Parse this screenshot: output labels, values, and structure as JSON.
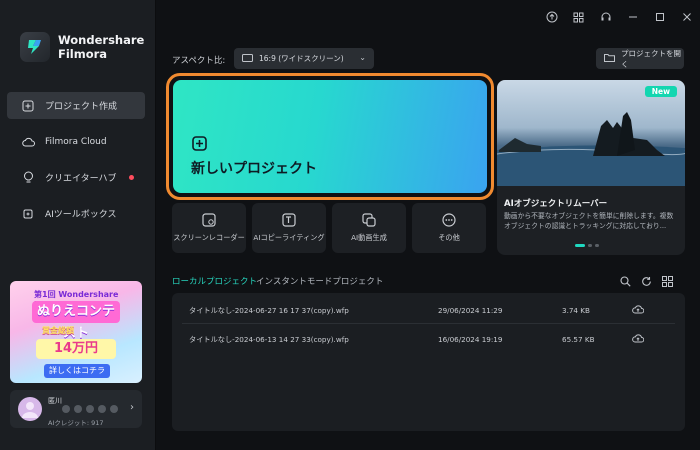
{
  "app": {
    "name_line1": "Wondershare",
    "name_line2": "Filmora",
    "accent": "#27d6bf"
  },
  "sidebar": {
    "items": [
      {
        "label": "プロジェクト作成",
        "icon": "new-project-icon",
        "active": true
      },
      {
        "label": "Filmora Cloud",
        "icon": "cloud-icon",
        "active": false
      },
      {
        "label": "クリエイターハブ",
        "icon": "lightbulb-icon",
        "active": false,
        "notification_dot": true
      },
      {
        "label": "AIツールボックス",
        "icon": "ai-toolbox-icon",
        "active": false
      }
    ],
    "banner": {
      "line1": "第1回 Wondershare Filmora",
      "line2": "ぬりえコンテスト",
      "line3": "賞金総額",
      "line4": "14万円",
      "line5": "詳しくはコチラ"
    },
    "user": {
      "name": "匿川",
      "credits": "AIクレジット: 917"
    }
  },
  "topbar": {
    "aspect_label": "アスペクト比:",
    "aspect_value": "16:9 (ワイドスクリーン)",
    "open_project": "プロジェクトを開く",
    "icons": [
      "upload-icon",
      "grid-icon",
      "headset-icon",
      "minimize-icon",
      "maximize-icon",
      "close-icon"
    ]
  },
  "new_project": {
    "label": "新しいプロジェクト"
  },
  "promo": {
    "badge": "New",
    "title": "AIオブジェクトリムーバー",
    "description": "動画から不要なオブジェクトを簡単に削除します。複数オブジェクトの認識とトラッキングに対応しており...",
    "page_count": 3,
    "current_page": 1
  },
  "tools": [
    {
      "label": "スクリーンレコーダー",
      "icon": "screen-recorder-icon"
    },
    {
      "label": "AIコピーライティング",
      "icon": "ai-copywriting-icon"
    },
    {
      "label": "AI動画生成",
      "icon": "ai-video-icon"
    },
    {
      "label": "その他",
      "icon": "more-icon"
    }
  ],
  "tabs": [
    {
      "label": "ローカルプロジェクト",
      "active": true
    },
    {
      "label": "インスタントモードプロジェクト",
      "active": false
    }
  ],
  "projects": [
    {
      "name": "タイトルなし-2024-06-27 16 17 37(copy).wfp",
      "date": "29/06/2024 11:29",
      "size": "3.74 KB"
    },
    {
      "name": "タイトルなし-2024-06-13 14 27 33(copy).wfp",
      "date": "16/06/2024 19:19",
      "size": "65.57 KB"
    }
  ]
}
